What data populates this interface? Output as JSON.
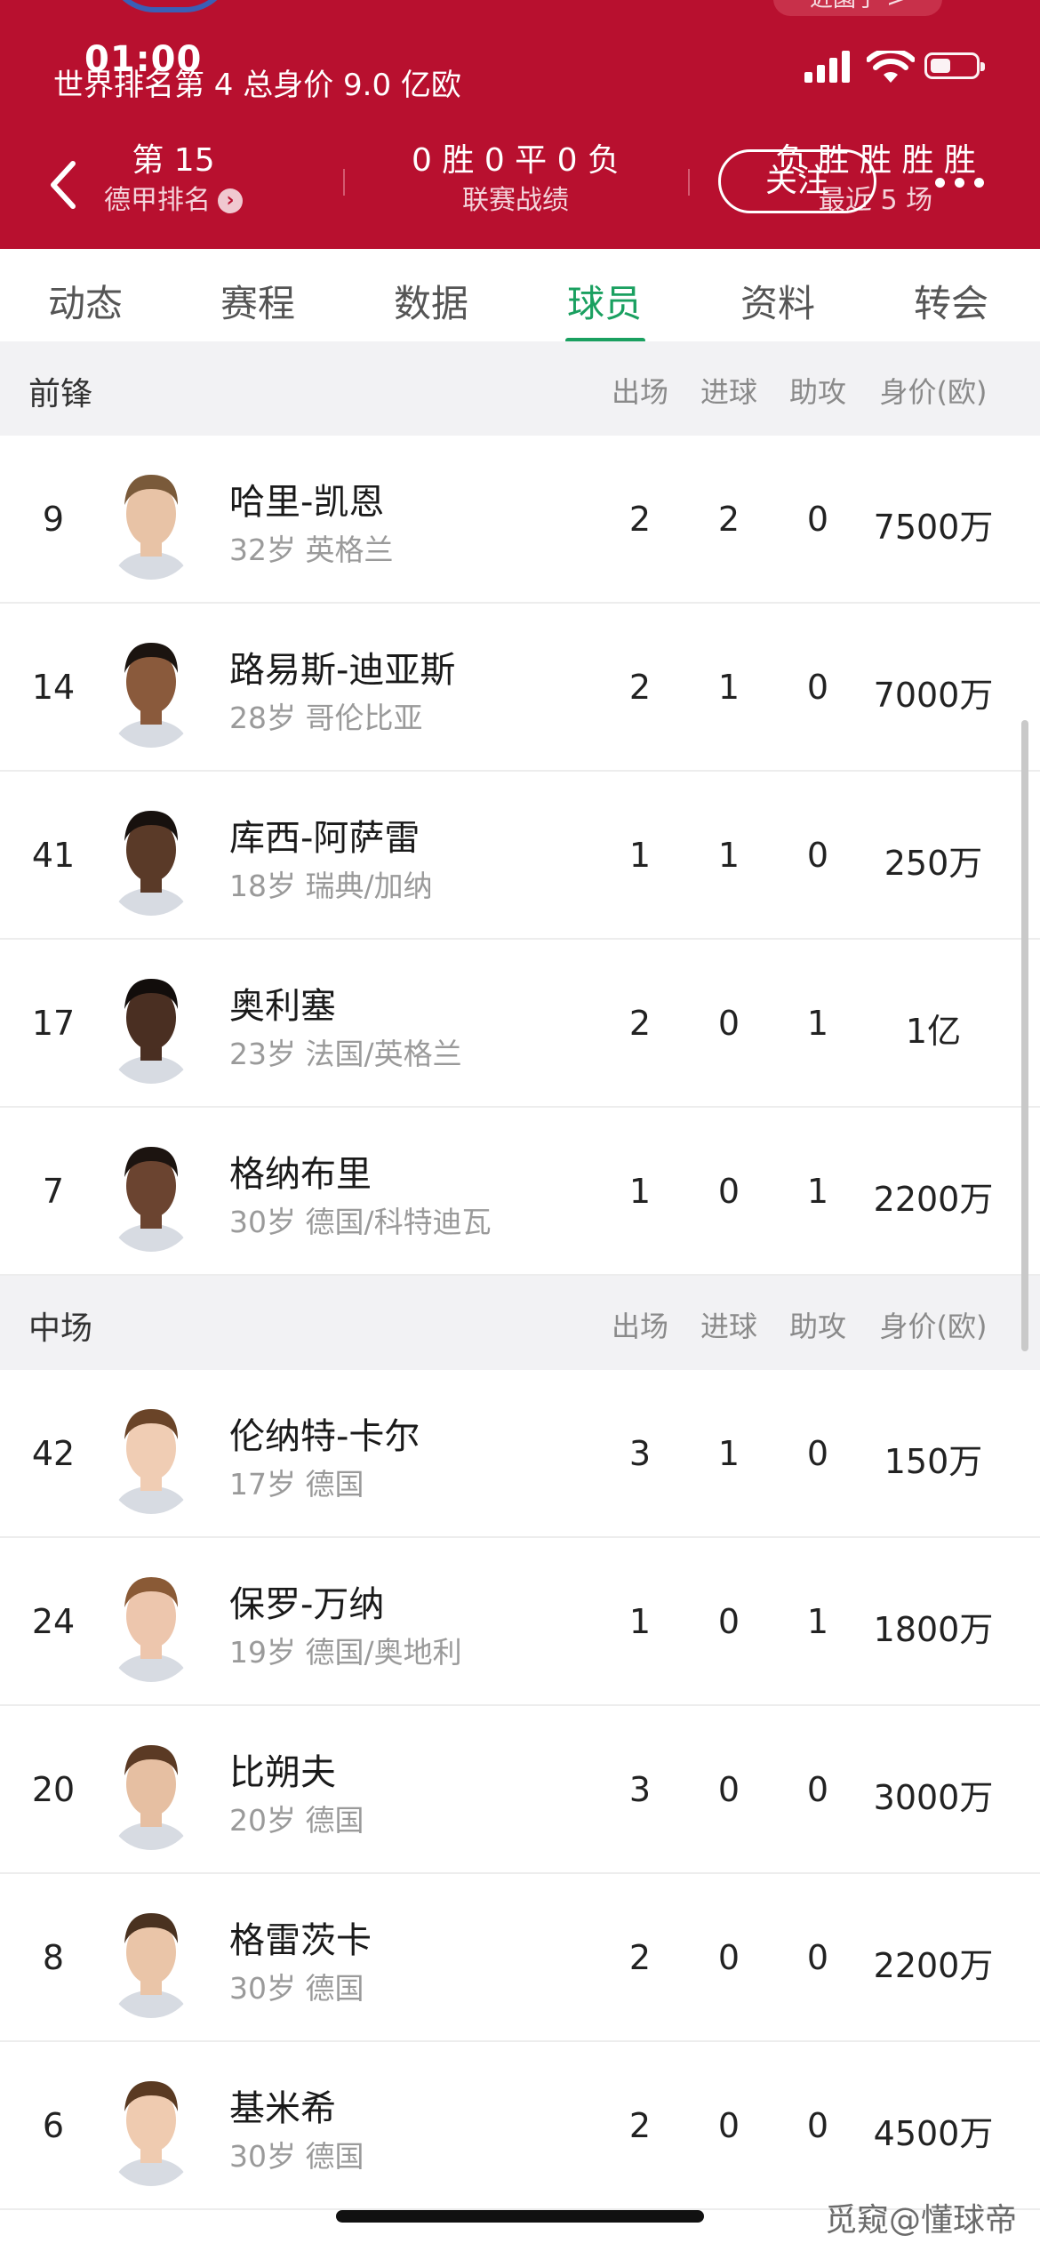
{
  "status": {
    "time": "01:00"
  },
  "header": {
    "pill_label": "近園子 >",
    "world_rank_text": "世界排名第 4  总身价 9.0 亿欧",
    "league_rank": {
      "value": "第 15",
      "label": "德甲排名"
    },
    "record": {
      "value": "0 胜  0 平  0 负",
      "label": "联赛战绩"
    },
    "recent": {
      "value": "负 胜 胜 胜 胜",
      "label": "最近 5 场"
    },
    "follow_label": "关注",
    "colors": {
      "brand": "#b8102f",
      "accent": "#1aa060"
    }
  },
  "tabs": [
    {
      "label": "动态"
    },
    {
      "label": "赛程"
    },
    {
      "label": "数据"
    },
    {
      "label": "球员",
      "active": true
    },
    {
      "label": "资料"
    },
    {
      "label": "转会"
    }
  ],
  "columns": [
    "出场",
    "进球",
    "助攻",
    "身价(欧)"
  ],
  "sections": [
    {
      "title": "前锋",
      "players": [
        {
          "number": "9",
          "name": "哈里-凯恩",
          "info": "32岁 英格兰",
          "apps": "2",
          "goals": "2",
          "assists": "0",
          "value": "7500万"
        },
        {
          "number": "14",
          "name": "路易斯-迪亚斯",
          "info": "28岁 哥伦比亚",
          "apps": "2",
          "goals": "1",
          "assists": "0",
          "value": "7000万"
        },
        {
          "number": "41",
          "name": "库西-阿萨雷",
          "info": "18岁 瑞典/加纳",
          "apps": "1",
          "goals": "1",
          "assists": "0",
          "value": "250万"
        },
        {
          "number": "17",
          "name": "奥利塞",
          "info": "23岁 法国/英格兰",
          "apps": "2",
          "goals": "0",
          "assists": "1",
          "value": "1亿"
        },
        {
          "number": "7",
          "name": "格纳布里",
          "info": "30岁 德国/科特迪瓦",
          "apps": "1",
          "goals": "0",
          "assists": "1",
          "value": "2200万"
        }
      ]
    },
    {
      "title": "中场",
      "players": [
        {
          "number": "42",
          "name": "伦纳特-卡尔",
          "info": "17岁 德国",
          "apps": "3",
          "goals": "1",
          "assists": "0",
          "value": "150万"
        },
        {
          "number": "24",
          "name": "保罗-万纳",
          "info": "19岁 德国/奥地利",
          "apps": "1",
          "goals": "0",
          "assists": "1",
          "value": "1800万"
        },
        {
          "number": "20",
          "name": "比朔夫",
          "info": "20岁 德国",
          "apps": "3",
          "goals": "0",
          "assists": "0",
          "value": "3000万"
        },
        {
          "number": "8",
          "name": "格雷茨卡",
          "info": "30岁 德国",
          "apps": "2",
          "goals": "0",
          "assists": "0",
          "value": "2200万"
        },
        {
          "number": "6",
          "name": "基米希",
          "info": "30岁 德国",
          "apps": "2",
          "goals": "0",
          "assists": "0",
          "value": "4500万"
        }
      ]
    }
  ],
  "watermark": "觅窥@懂球帝"
}
